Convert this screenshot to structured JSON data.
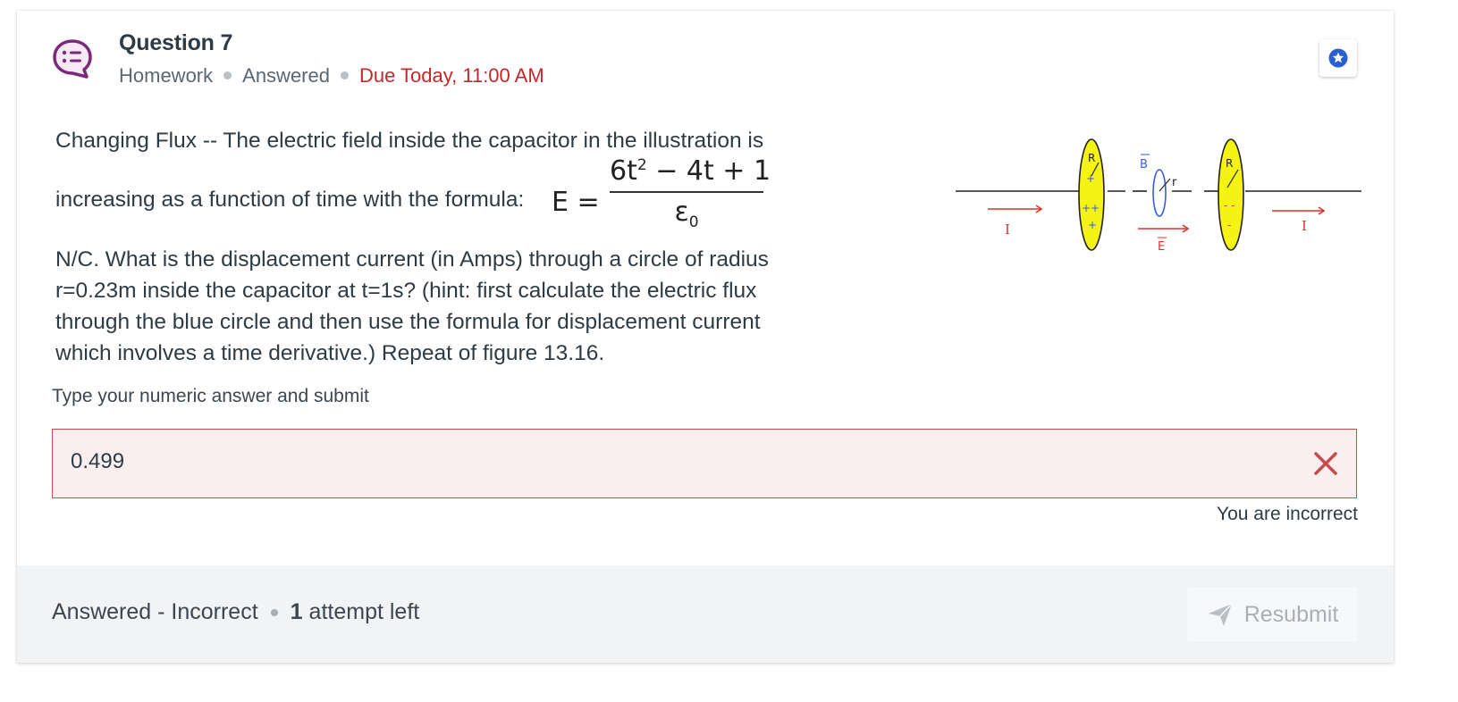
{
  "header": {
    "title": "Question 7",
    "category": "Homework",
    "state": "Answered",
    "due": "Due Today, 11:00 AM"
  },
  "question": {
    "line1": "Changing Flux -- The electric field inside the capacitor in the illustration is",
    "line2_prefix": "increasing as a function of time with the formula:",
    "formula": {
      "lhs": "E",
      "equals": "=",
      "numerator_a": "6t",
      "numerator_exp": "2",
      "numerator_b": " − 4t + 1",
      "denominator": "ε",
      "denominator_sub": "0"
    },
    "line3": "N/C. What is the displacement current (in Amps) through a circle of radius",
    "line4": "r=0.23m inside the capacitor at t=1s? (hint: first calculate the electric flux",
    "line5": "through the blue circle and then use the formula for displacement current",
    "line6": "which involves a time derivative.) Repeat of figure 13.16."
  },
  "figure": {
    "labels": {
      "current_left": "I",
      "current_right": "I",
      "b_field": "B",
      "e_field": "E",
      "radius": "r",
      "plate_left": "R",
      "plate_right": "R"
    },
    "colors": {
      "plate": "#f5f216",
      "current": "#e0322a",
      "field": "#3a5ee0"
    }
  },
  "answer": {
    "prompt": "Type your numeric answer and submit",
    "value": "0.499",
    "feedback": "You are incorrect",
    "icon": "close-icon"
  },
  "footer": {
    "status": "Answered - Incorrect",
    "attempts_count": "1",
    "attempts_label": "attempt left",
    "resubmit_label": "Resubmit"
  },
  "colors": {
    "accent_purple": "#7a2a7a",
    "error_red": "#c0282c",
    "star_blue": "#2b5fd0"
  }
}
